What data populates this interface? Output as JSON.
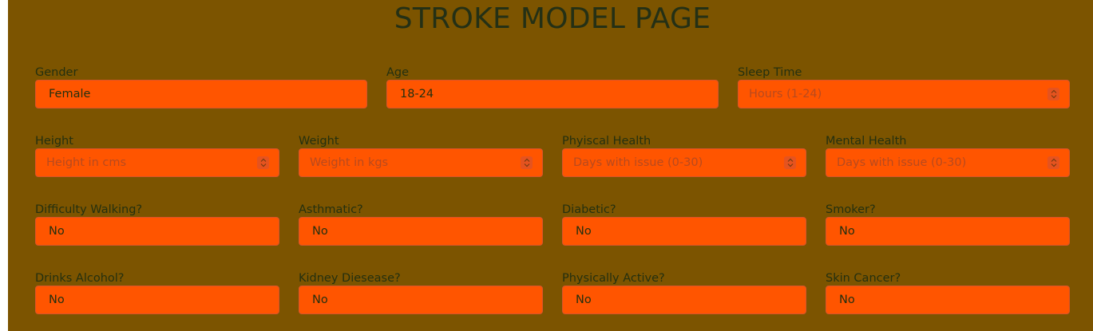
{
  "page": {
    "title": "STROKE MODEL PAGE"
  },
  "fields": {
    "gender": {
      "label": "Gender",
      "value": "Female"
    },
    "age": {
      "label": "Age",
      "value": "18-24"
    },
    "sleep_time": {
      "label": "Sleep Time",
      "placeholder": "Hours (1-24)"
    },
    "height": {
      "label": "Height",
      "placeholder": "Height in cms"
    },
    "weight": {
      "label": "Weight",
      "placeholder": "Weight in kgs"
    },
    "physical_health": {
      "label": "Phyiscal Health",
      "placeholder": "Days with issue (0-30)"
    },
    "mental_health": {
      "label": "Mental Health",
      "placeholder": "Days with issue (0-30)"
    },
    "difficulty_walking": {
      "label": "Difficulty Walking?",
      "value": "No"
    },
    "asthmatic": {
      "label": "Asthmatic?",
      "value": "No"
    },
    "diabetic": {
      "label": "Diabetic?",
      "value": "No"
    },
    "smoker": {
      "label": "Smoker?",
      "value": "No"
    },
    "drinks_alcohol": {
      "label": "Drinks Alcohol?",
      "value": "No"
    },
    "kidney_disease": {
      "label": "Kidney Diesease?",
      "value": "No"
    },
    "physically_active": {
      "label": "Physically Active?",
      "value": "No"
    },
    "skin_cancer": {
      "label": "Skin Cancer?",
      "value": "No"
    }
  },
  "icons": {
    "spinner": "up-down-spinner-icon"
  },
  "colors": {
    "panel_background": "#7c5400",
    "field_background": "#ff5500",
    "text": "#24300f",
    "placeholder": "#b84a1e"
  }
}
